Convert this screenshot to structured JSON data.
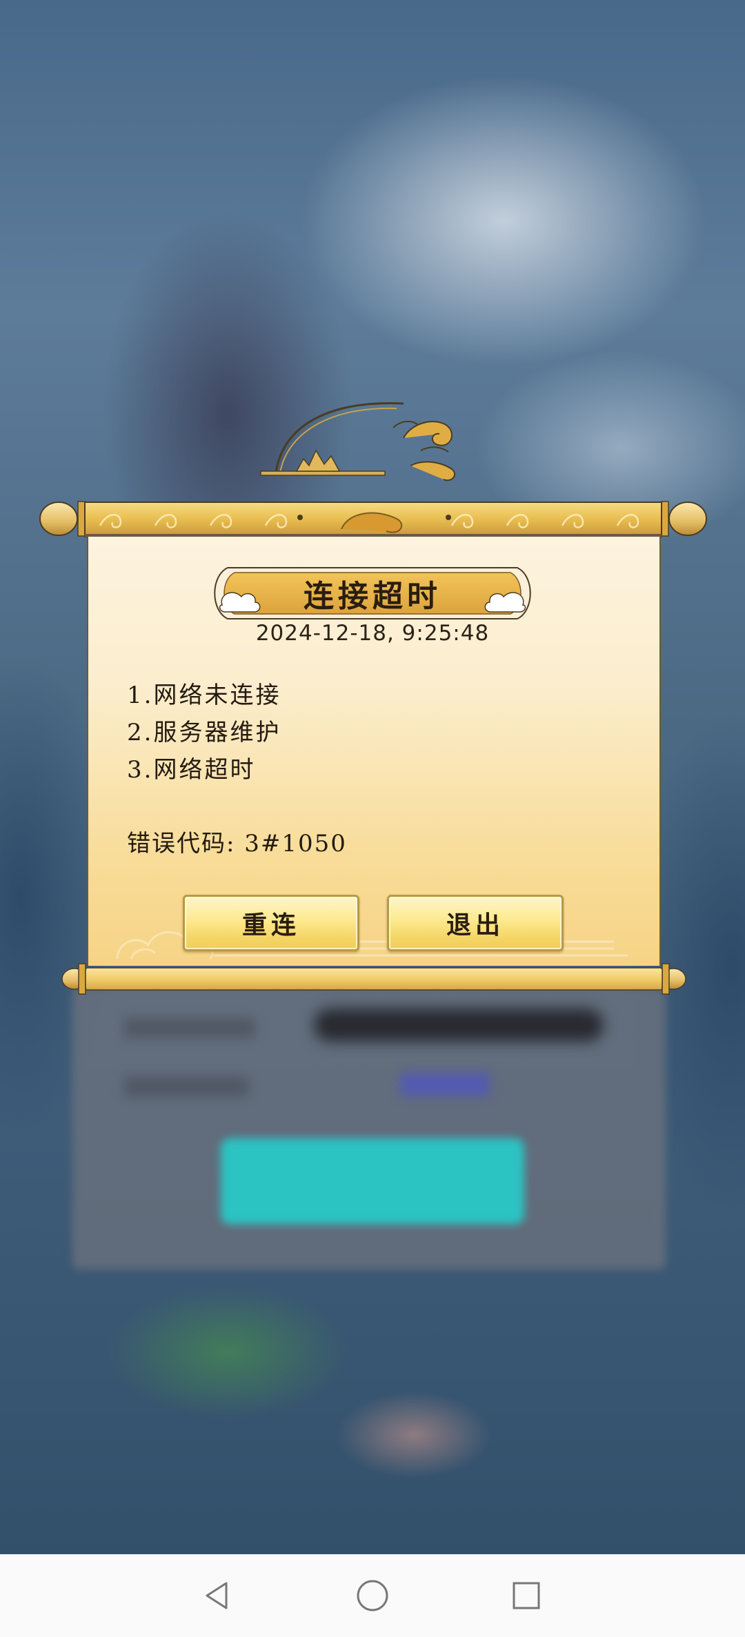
{
  "dialog": {
    "title": "连接超时",
    "timestamp": "2024-12-18, 9:25:48",
    "reasons": [
      "1.网络未连接",
      "2.服务器维护",
      "3.网络超时"
    ],
    "error_code": "错误代码: 3#1050",
    "buttons": {
      "reconnect": "重连",
      "exit": "退出"
    }
  },
  "navbar": {
    "icons": [
      "back-icon",
      "home-icon",
      "recent-apps-icon"
    ]
  },
  "colors": {
    "gold": "#e8b84a",
    "paper": "#fbedcd",
    "text": "#231a10",
    "teal_button": "#2cc3c3"
  }
}
